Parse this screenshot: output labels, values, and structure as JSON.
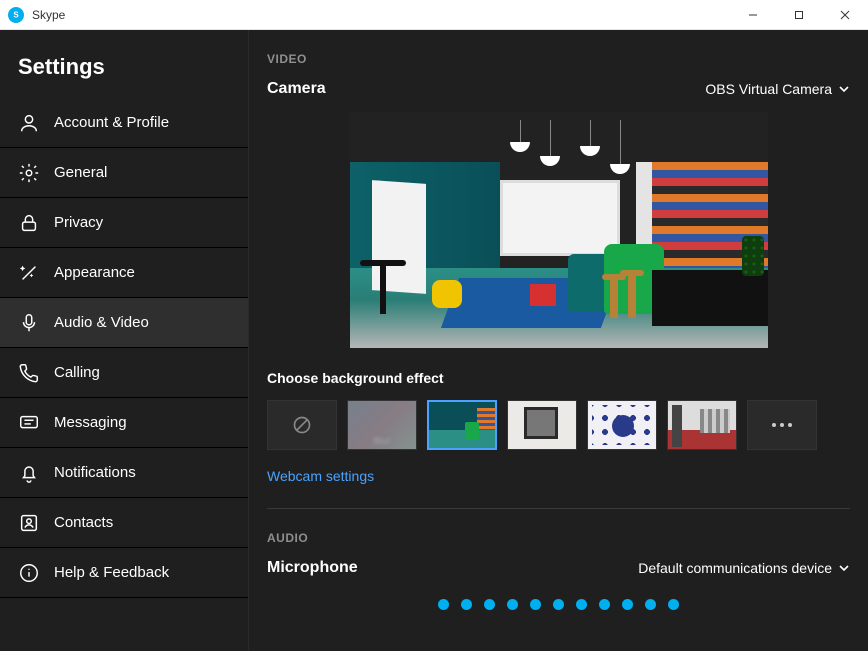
{
  "titlebar": {
    "app_name": "Skype"
  },
  "sidebar": {
    "title": "Settings",
    "items": [
      {
        "label": "Account & Profile",
        "icon": "person-icon"
      },
      {
        "label": "General",
        "icon": "gear-icon"
      },
      {
        "label": "Privacy",
        "icon": "lock-icon"
      },
      {
        "label": "Appearance",
        "icon": "wand-icon"
      },
      {
        "label": "Audio & Video",
        "icon": "mic-icon",
        "selected": true
      },
      {
        "label": "Calling",
        "icon": "phone-icon"
      },
      {
        "label": "Messaging",
        "icon": "message-icon"
      },
      {
        "label": "Notifications",
        "icon": "bell-icon"
      },
      {
        "label": "Contacts",
        "icon": "contacts-icon"
      },
      {
        "label": "Help & Feedback",
        "icon": "info-icon"
      }
    ]
  },
  "video": {
    "section_label": "VIDEO",
    "camera_label": "Camera",
    "camera_selected": "OBS Virtual Camera",
    "bg_label": "Choose background effect",
    "thumbs": {
      "none": "None",
      "blur": "Blur"
    },
    "webcam_link": "Webcam settings"
  },
  "audio": {
    "section_label": "AUDIO",
    "mic_label": "Microphone",
    "mic_selected": "Default communications device",
    "level_dots": 11
  }
}
